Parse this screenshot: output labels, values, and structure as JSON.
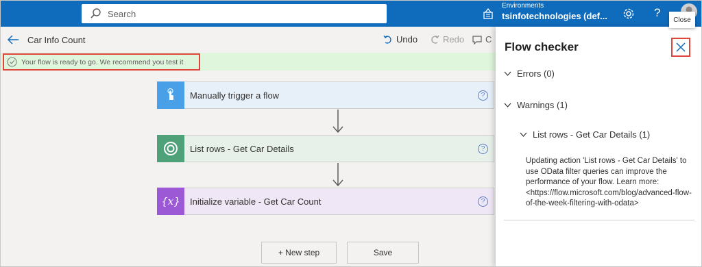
{
  "topbar": {
    "search_placeholder": "Search",
    "env_label": "Environments",
    "env_name": "tsinfotechnologies (def...",
    "help": "?"
  },
  "cmdbar": {
    "flow_name": "Car Info Count",
    "undo": "Undo",
    "redo": "Redo",
    "comment": "C"
  },
  "banner": {
    "text": "Your flow is ready to go. We recommend you test it"
  },
  "steps": [
    {
      "title": "Manually trigger a flow"
    },
    {
      "title": "List rows - Get Car Details"
    },
    {
      "title": "Initialize variable - Get Car Count",
      "icon_text": "{x}"
    }
  ],
  "buttons": {
    "new_step": "+ New step",
    "save": "Save"
  },
  "panel": {
    "title": "Flow checker",
    "close_tooltip": "Close",
    "errors": "Errors (0)",
    "warnings": "Warnings (1)",
    "warning_item": "List rows - Get Car Details (1)",
    "warning_desc": "Updating action 'List rows - Get Car Details' to use OData filter queries can improve the performance of your flow. Learn more: <https://flow.microsoft.com/blog/advanced-flow-of-the-week-filtering-with-odata>"
  },
  "colors": {
    "topbar": "#0f6cbd",
    "banner": "#dff6dd",
    "highlight": "#e0453b"
  }
}
